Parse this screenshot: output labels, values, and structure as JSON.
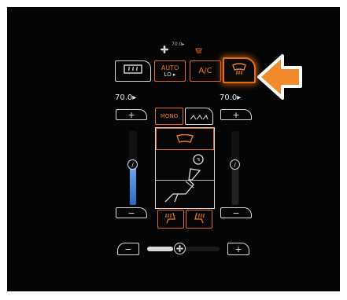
{
  "status": {
    "temp_text": "70.0▸"
  },
  "top_buttons": {
    "rear_defrost_label": "",
    "auto_label": "AUTO",
    "auto_sub": "LO ▸",
    "ac_label": "A/C",
    "front_defrost_label": ""
  },
  "left": {
    "temp": "70.0▸",
    "plus": "+",
    "minus": "−",
    "slider_level": 0.45
  },
  "right": {
    "temp": "70.0▸",
    "plus": "+",
    "minus": "−",
    "slider_level": 0.45
  },
  "center": {
    "mono_label": "MONO"
  },
  "fan": {
    "minus": "−",
    "plus": "+",
    "level": 0.33
  },
  "colors": {
    "accent": "#e56b12",
    "blue": "#3c7fd6",
    "background": "#050505"
  },
  "icons": [
    "fan-icon",
    "rear-defrost-icon",
    "front-defrost-icon",
    "windshield-icon",
    "seat-icon",
    "seat-heat-icon",
    "pointer-arrow-icon"
  ]
}
